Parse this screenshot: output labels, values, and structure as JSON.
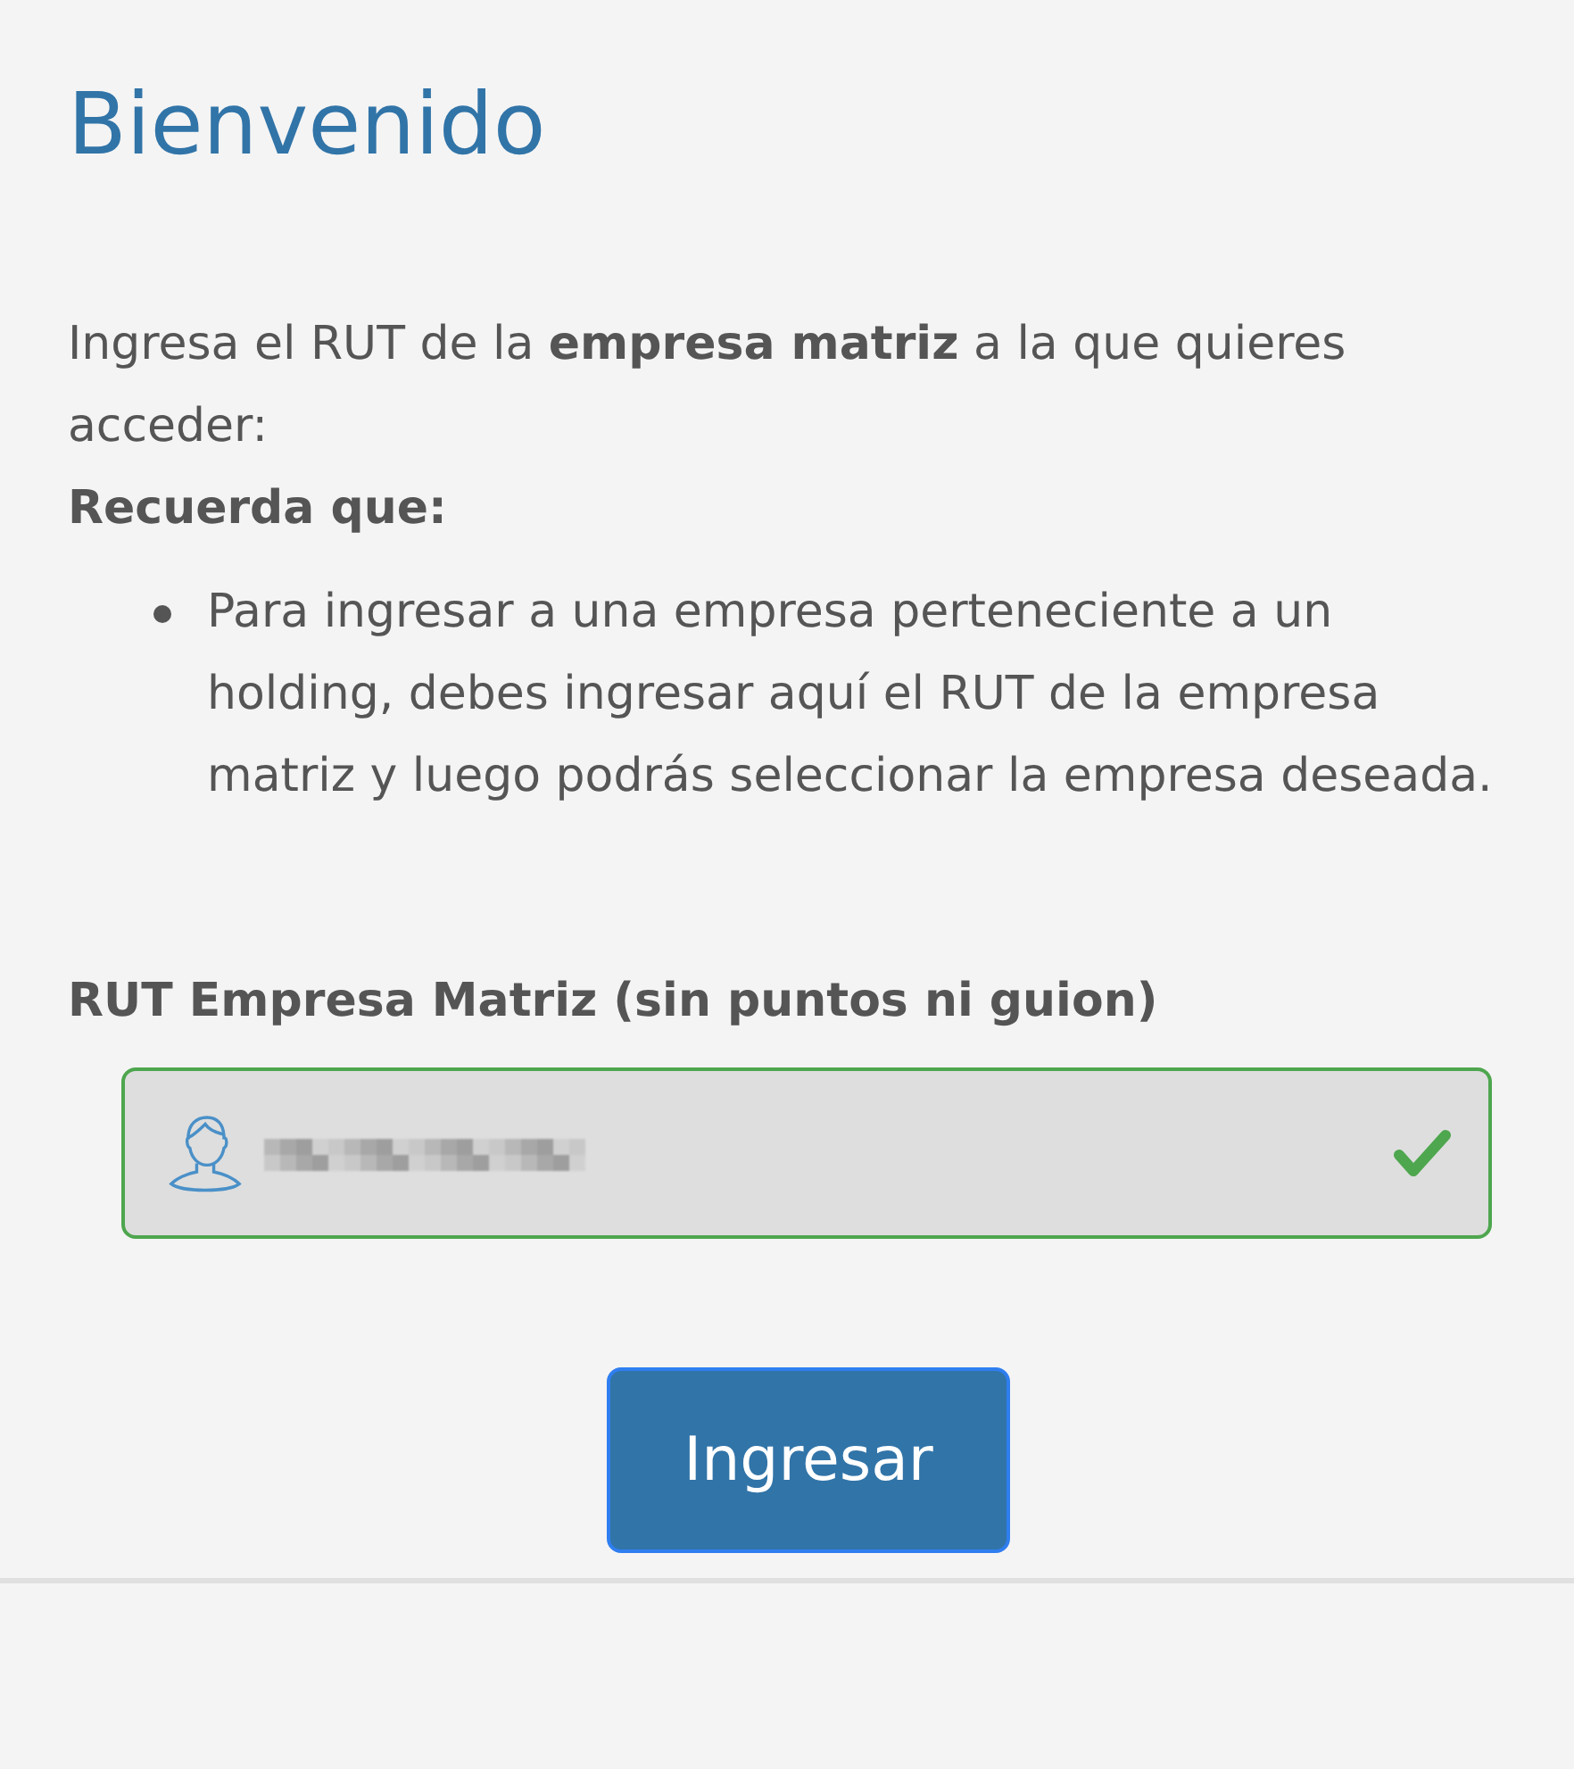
{
  "title": "Bienvenido",
  "intro": "Ingresa el RUT de la **empresa matriz** a la que quieres acceder:",
  "reminder_title": "Recuerda que:",
  "reminders": [
    "Para ingresar a una empresa perteneciente a un holding, debes ingresar aquí el RUT de la empresa matriz y luego podrás seleccionar la empresa deseada."
  ],
  "field": {
    "label": "RUT Empresa Matriz (sin puntos ni guion)",
    "valid": true
  },
  "submit_button": "Ingresar"
}
